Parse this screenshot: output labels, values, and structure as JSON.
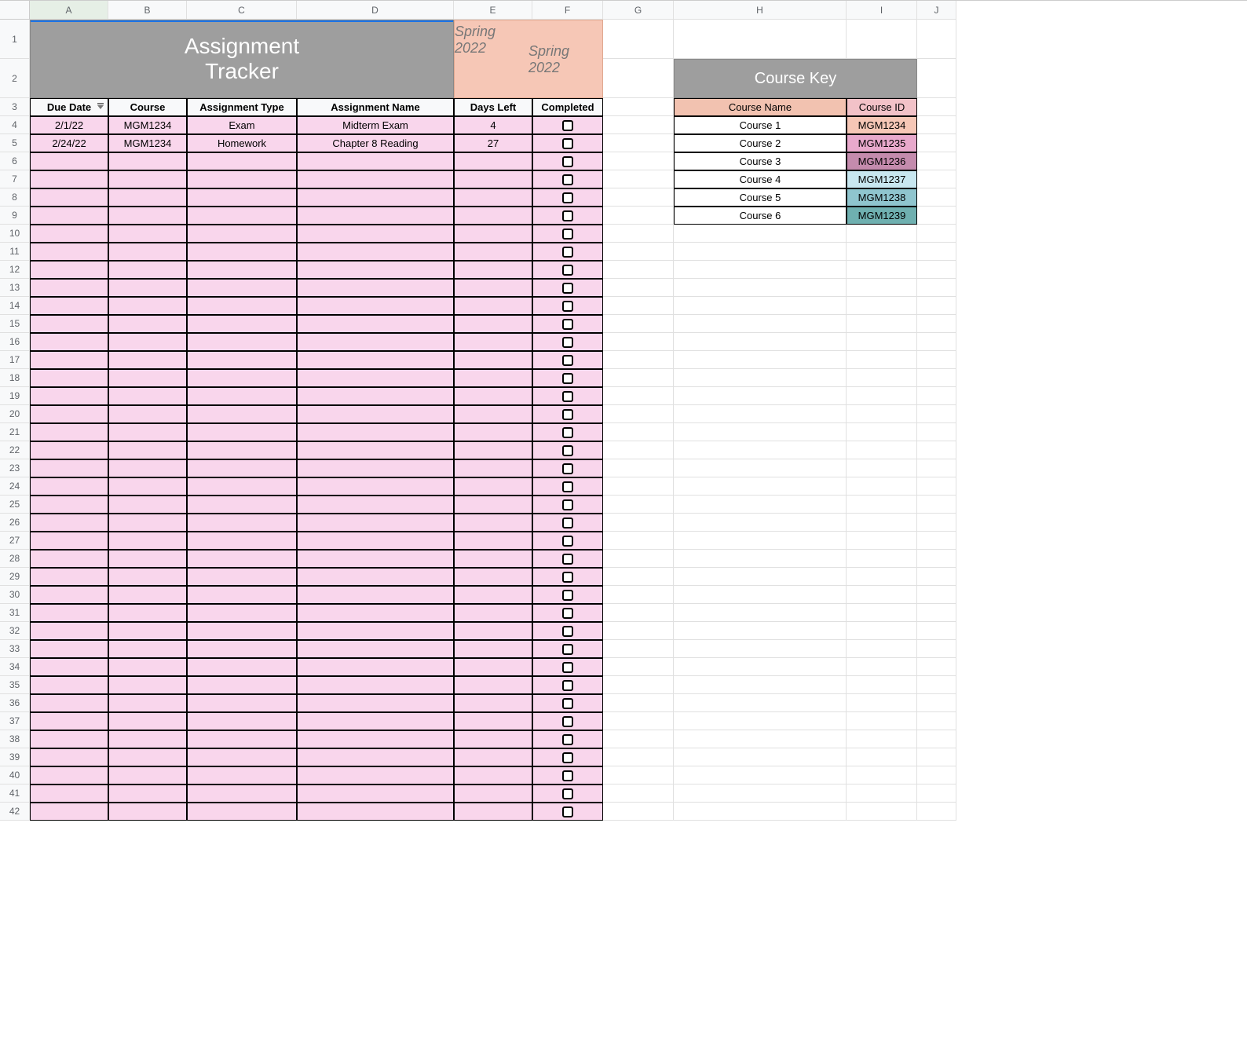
{
  "columns": [
    "A",
    "B",
    "C",
    "D",
    "E",
    "F",
    "G",
    "H",
    "I",
    "J"
  ],
  "rows": 42,
  "title": {
    "line1": "Assignment",
    "line2": "Tracker"
  },
  "term": "Spring 2022",
  "tracker": {
    "headers": [
      "Due Date",
      "Course",
      "Assignment Type",
      "Assignment Name",
      "Days Left",
      "Completed"
    ],
    "rows": [
      {
        "due": "2/1/22",
        "course": "MGM1234",
        "type": "Exam",
        "name": "Midterm Exam",
        "days": "4",
        "completed": false
      },
      {
        "due": "2/24/22",
        "course": "MGM1234",
        "type": "Homework",
        "name": "Chapter 8 Reading",
        "days": "27",
        "completed": false
      }
    ]
  },
  "course_key": {
    "title": "Course Key",
    "headers": [
      "Course Name",
      "Course ID"
    ],
    "rows": [
      {
        "name": "Course 1",
        "id": "MGM1234",
        "color": "#f6c7b6"
      },
      {
        "name": "Course 2",
        "id": "MGM1235",
        "color": "#e8a9cc"
      },
      {
        "name": "Course 3",
        "id": "MGM1236",
        "color": "#c48bad"
      },
      {
        "name": "Course 4",
        "id": "MGM1237",
        "color": "#c8e7f0"
      },
      {
        "name": "Course 5",
        "id": "MGM1238",
        "color": "#8fc5ce"
      },
      {
        "name": "Course 6",
        "id": "MGM1239",
        "color": "#6fb0b0"
      }
    ]
  },
  "colors": {
    "pink": "#f9d6ec",
    "peach": "#f6c7b6",
    "gray": "#9e9e9e",
    "ck_head_peach": "#f2c2b0",
    "ck_head_pink": "#f2c2c8"
  }
}
